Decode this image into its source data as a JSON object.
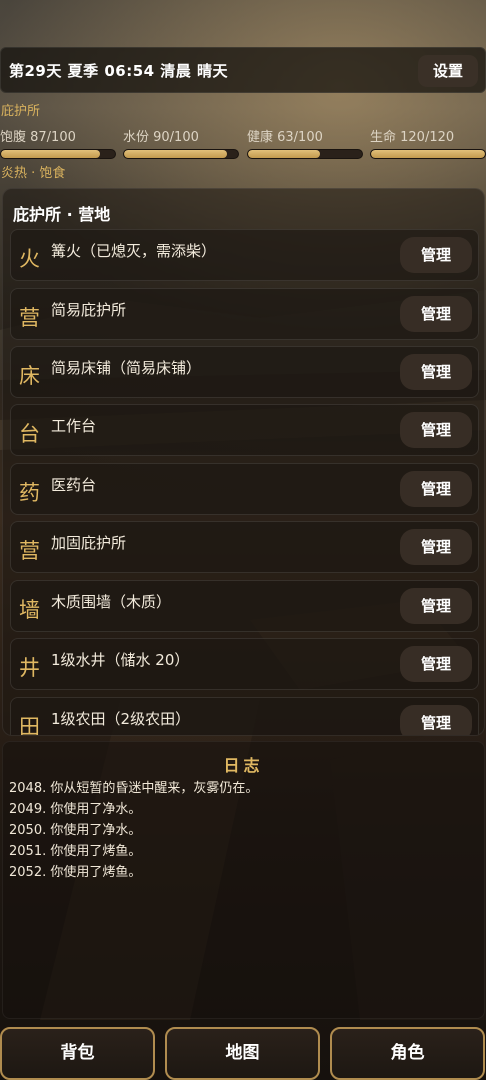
{
  "header": {
    "status": "第29天  夏季  06:54 清晨  晴天",
    "settings_label": "设置"
  },
  "location_label": "庇护所",
  "stats": [
    {
      "label": "饱腹 87/100",
      "value": 87,
      "max": 100
    },
    {
      "label": "水份 90/100",
      "value": 90,
      "max": 100
    },
    {
      "label": "健康 63/100",
      "value": 63,
      "max": 100
    },
    {
      "label": "生命 120/120",
      "value": 120,
      "max": 120
    }
  ],
  "conditions": "炎热 · 饱食",
  "panel": {
    "title": "庇护所 · 营地",
    "manage_label": "管理",
    "buildings": [
      {
        "icon": "火",
        "name": "篝火（已熄灭，需添柴）",
        "manage": "管理"
      },
      {
        "icon": "营",
        "name": "简易庇护所",
        "manage": "管理"
      },
      {
        "icon": "床",
        "name": "简易床铺（简易床铺）",
        "manage": "管理"
      },
      {
        "icon": "台",
        "name": "工作台",
        "manage": "管理"
      },
      {
        "icon": "药",
        "name": "医药台",
        "manage": "管理"
      },
      {
        "icon": "营",
        "name": "加固庇护所",
        "manage": "管理"
      },
      {
        "icon": "墙",
        "name": "木质围墙（木质）",
        "manage": "管理"
      },
      {
        "icon": "井",
        "name": "1级水井（储水 20）",
        "manage": "管理"
      },
      {
        "icon": "田",
        "name": "1级农田（2级农田）",
        "manage": "管理"
      }
    ]
  },
  "log": {
    "title": "日志",
    "entries": [
      "2048. 你从短暂的昏迷中醒来，灰雾仍在。",
      "2049. 你使用了净水。",
      "2050. 你使用了净水。",
      "2051. 你使用了烤鱼。",
      "2052. 你使用了烤鱼。"
    ]
  },
  "nav": {
    "backpack": "背包",
    "map": "地图",
    "character": "角色"
  },
  "colors": {
    "accent": "#e0b862",
    "bar_fill": "#d3ae63",
    "nav_border": "#b08c4f"
  }
}
